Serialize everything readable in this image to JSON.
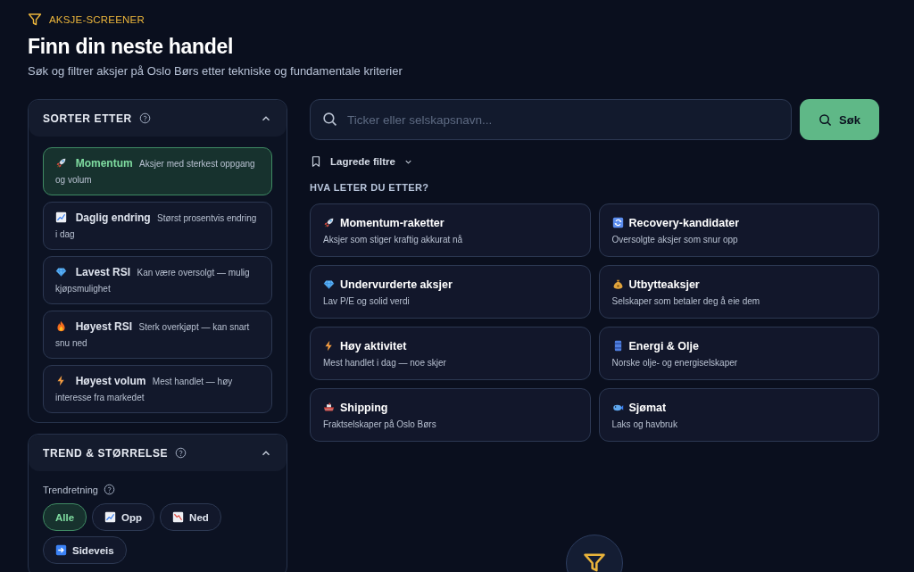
{
  "header": {
    "eyebrow": "AKSJE-SCREENER",
    "title": "Finn din neste handel",
    "subtitle": "Søk og filtrer aksjer på Oslo Børs etter tekniske og fundamentale kriterier"
  },
  "sort_panel": {
    "title": "SORTER ETTER",
    "expanded": true,
    "options": [
      {
        "label": "Momentum",
        "description": "Aksjer med sterkest oppgang og volum",
        "selected": true
      },
      {
        "label": "Daglig endring",
        "description": "Størst prosentvis endring i dag",
        "selected": false
      },
      {
        "label": "Lavest RSI",
        "description": "Kan være oversolgt — mulig kjøpsmulighet",
        "selected": false
      },
      {
        "label": "Høyest RSI",
        "description": "Sterk overkjøpt — kan snart snu ned",
        "selected": false
      },
      {
        "label": "Høyest volum",
        "description": "Mest handlet — høy interesse fra markedet",
        "selected": false
      }
    ]
  },
  "trend_panel": {
    "title": "TREND & STØRRELSE",
    "expanded": true,
    "field_label": "Trendretning",
    "chips": [
      {
        "label": "Alle",
        "selected": true
      },
      {
        "label": "Opp",
        "selected": false
      },
      {
        "label": "Ned",
        "selected": false
      },
      {
        "label": "Sideveis",
        "selected": false
      }
    ]
  },
  "search": {
    "placeholder": "Ticker eller selskapsnavn...",
    "button": "Søk"
  },
  "saved_filters": "Lagrede filtre",
  "presets": {
    "title": "HVA LETER DU ETTER?",
    "items": [
      {
        "title": "Momentum-raketter",
        "description": "Aksjer som stiger kraftig akkurat nå"
      },
      {
        "title": "Recovery-kandidater",
        "description": "Oversolgte aksjer som snur opp"
      },
      {
        "title": "Undervurderte aksjer",
        "description": "Lav P/E og solid verdi"
      },
      {
        "title": "Utbytteaksjer",
        "description": "Selskaper som betaler deg å eie dem"
      },
      {
        "title": "Høy aktivitet",
        "description": "Mest handlet i dag — noe skjer"
      },
      {
        "title": "Energi & Olje",
        "description": "Norske olje- og energiselskaper"
      },
      {
        "title": "Shipping",
        "description": "Fraktselskaper på Oslo Børs"
      },
      {
        "title": "Sjømat",
        "description": "Laks og havbruk"
      }
    ]
  }
}
